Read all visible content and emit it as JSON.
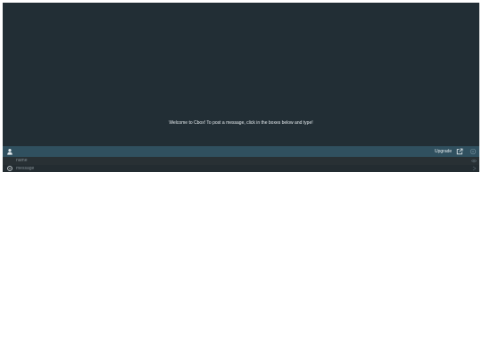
{
  "messages": {
    "welcome_text": "Welcome to Cbox! To post a message, click in the boxes below and type!"
  },
  "toolbar": {
    "user_icon": "user-icon",
    "upgrade_label": "Upgrade",
    "popout_icon": "external-link-icon",
    "menu_icon": "menu-icon"
  },
  "form": {
    "name_placeholder": "name",
    "name_value": "",
    "message_placeholder": "message",
    "message_value": "",
    "eye_icon": "eye-icon",
    "emoji_icon": "emoji-icon",
    "send_icon": "send-icon"
  },
  "colors": {
    "background": "#222e35",
    "toolbar": "#30505f",
    "name_row": "#283034",
    "message_row": "#232c31",
    "text": "#e6ecef"
  }
}
